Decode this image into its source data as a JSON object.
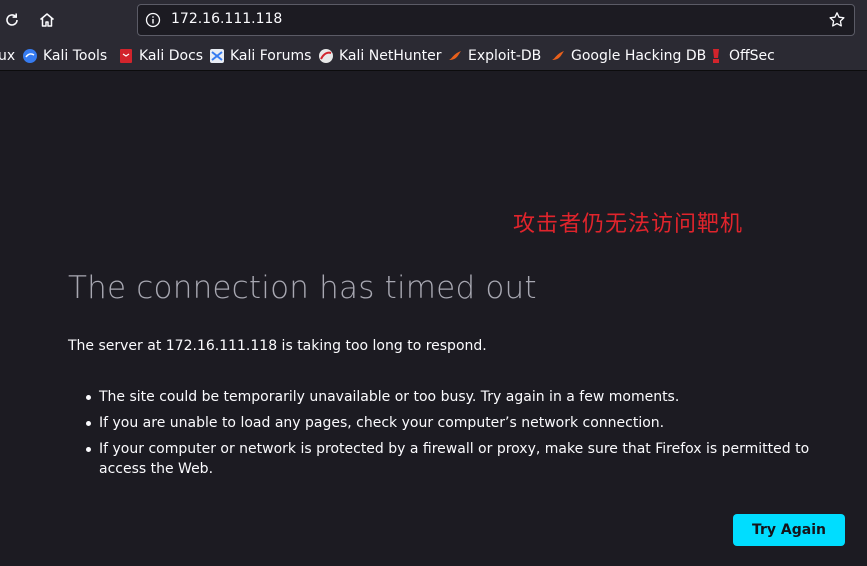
{
  "browser": {
    "url": "172.16.111.118"
  },
  "bookmarks": [
    {
      "label": "ux",
      "icon": "partial-icon"
    },
    {
      "label": "Kali Tools",
      "icon": "kali-tools-icon"
    },
    {
      "label": "Kali Docs",
      "icon": "kali-docs-icon"
    },
    {
      "label": "Kali Forums",
      "icon": "kali-forums-icon"
    },
    {
      "label": "Kali NetHunter",
      "icon": "kali-nethunter-icon"
    },
    {
      "label": "Exploit-DB",
      "icon": "exploit-db-icon"
    },
    {
      "label": "Google Hacking DB",
      "icon": "ghdb-icon"
    },
    {
      "label": "OffSec",
      "icon": "offsec-icon"
    }
  ],
  "error": {
    "annotation": "攻击者仍无法访问靶机",
    "title": "The connection has timed out",
    "description": "The server at 172.16.111.118 is taking too long to respond.",
    "bullets": [
      "The site could be temporarily unavailable or too busy. Try again in a few moments.",
      "If you are unable to load any pages, check your computer’s network connection.",
      "If your computer or network is protected by a firewall or proxy, make sure that Firefox is permitted to access the Web."
    ],
    "try_again_label": "Try Again"
  },
  "colors": {
    "background": "#1c1b22",
    "toolbar": "#2b2a33",
    "accent_button": "#00ddff",
    "annotation": "#e0242c"
  }
}
